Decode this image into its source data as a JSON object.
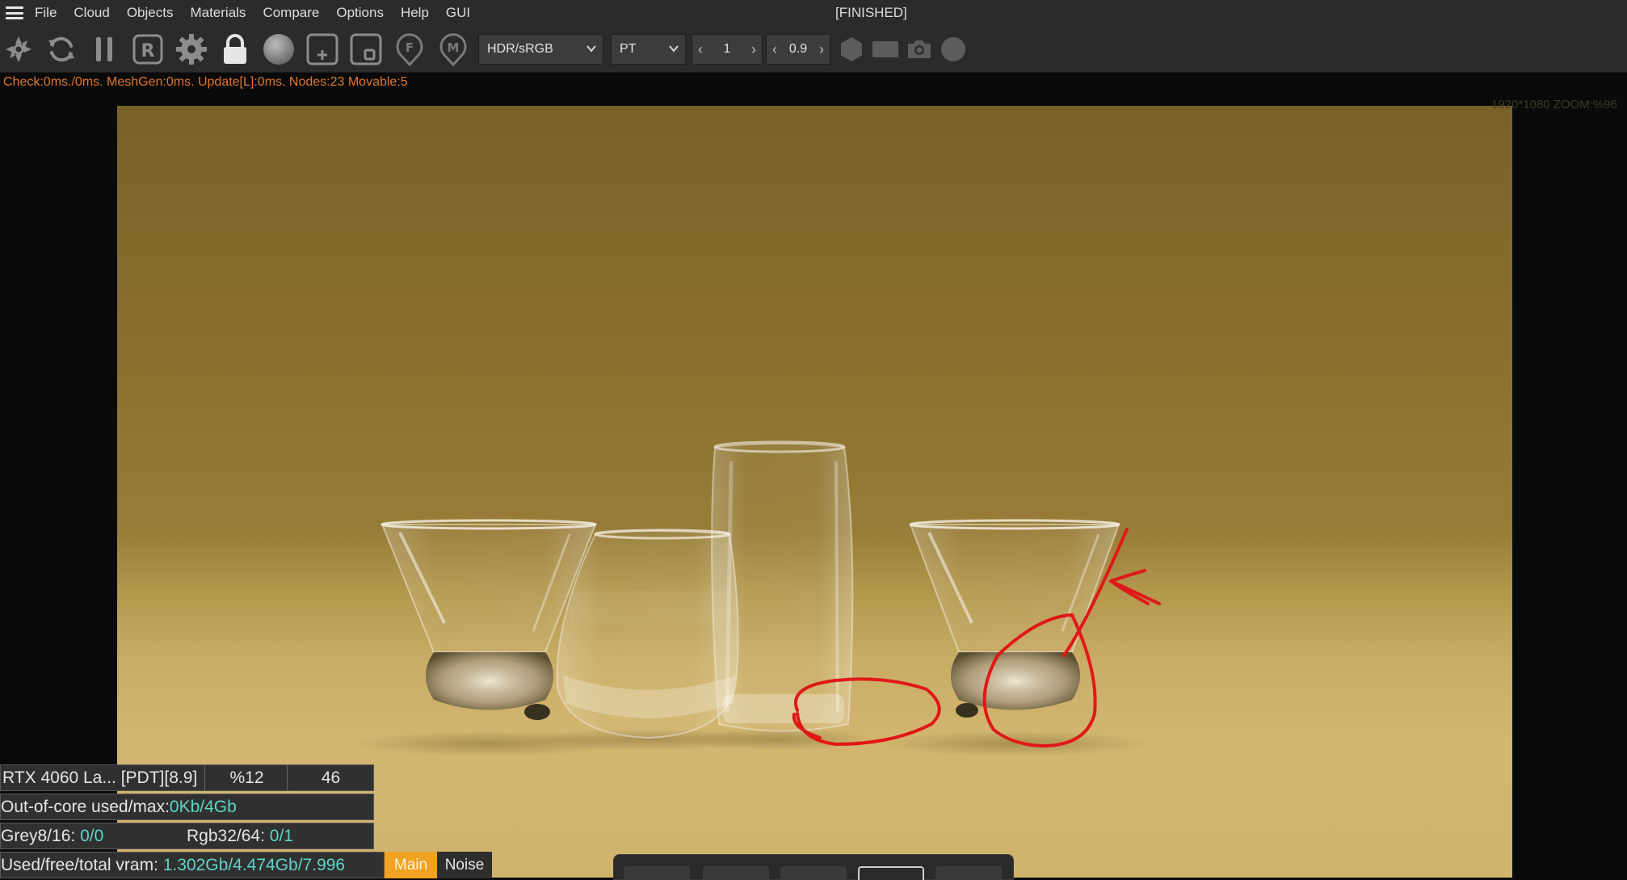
{
  "menu": {
    "items": [
      "File",
      "Cloud",
      "Objects",
      "Materials",
      "Compare",
      "Options",
      "Help",
      "GUI"
    ]
  },
  "window": {
    "status": "[FINISHED]"
  },
  "toolbar": {
    "tonemap_select": "HDR/sRGB",
    "kernel_select": "PT",
    "stepper1_value": "1",
    "stepper2_value": "0.9"
  },
  "stats": {
    "line": "Check:0ms./0ms. MeshGen:0ms. Update[L]:0ms. Nodes:23 Movable:5",
    "zoom": "1920*1080 ZOOM:%96"
  },
  "info": {
    "gpu_name": "RTX 4060 La... [PDT][8.9]",
    "percent": "%12",
    "count": "46",
    "ooc_label": "Out-of-core used/max:",
    "ooc_value": "0Kb/4Gb",
    "grey_label": "Grey8/16:",
    "grey_value": "0/0",
    "rgb_label": "Rgb32/64:",
    "rgb_value": "0/1",
    "vram_label": "Used/free/total vram:",
    "vram_value": "1.302Gb/4.474Gb/7.996"
  },
  "tabs": {
    "main": "Main",
    "noise": "Noise"
  },
  "colors": {
    "accent_orange": "#f2a222",
    "stats_text": "#e0762f",
    "value_teal": "#5fd5c8",
    "annotation_red": "#e01818"
  },
  "icons": [
    "cog-spinner-icon",
    "refresh-icon",
    "pause-icon",
    "r-box-icon",
    "gear-icon",
    "lock-icon",
    "sphere-icon",
    "add-box-icon",
    "box-icon",
    "f-pin-icon",
    "m-pin-icon",
    "hexagon-icon",
    "rectangle-icon",
    "camera-icon",
    "circle-icon"
  ]
}
